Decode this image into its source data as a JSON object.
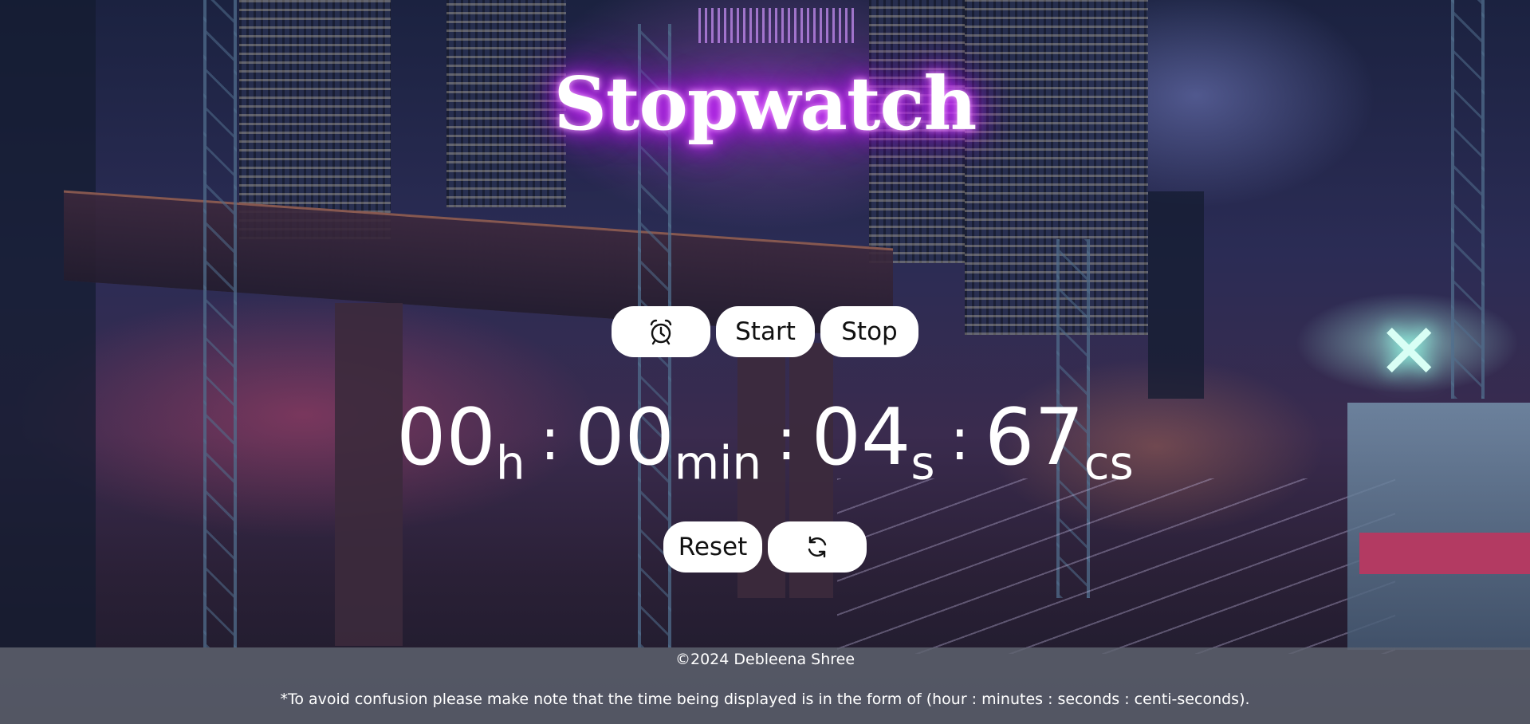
{
  "header": {
    "title": "Stopwatch"
  },
  "controls_top": {
    "alarm_icon": "alarm-clock-icon",
    "start_label": "Start",
    "stop_label": "Stop"
  },
  "display": {
    "hours": "00",
    "hours_unit": "h",
    "minutes": "00",
    "minutes_unit": "min",
    "seconds": "04",
    "seconds_unit": "s",
    "centiseconds": "67",
    "centiseconds_unit": "cs",
    "separator": ":"
  },
  "controls_bottom": {
    "reset_label": "Reset",
    "refresh_icon": "refresh-icon"
  },
  "footer": {
    "copyright": "©2024 Debleena Shree",
    "note": "*To avoid confusion please make note that the time being displayed is in the form of (hour : minutes : seconds : centi-seconds)."
  },
  "colors": {
    "title_glow": "#d23cff",
    "button_bg": "#ffffff",
    "footer_bg": "#5f6470"
  }
}
